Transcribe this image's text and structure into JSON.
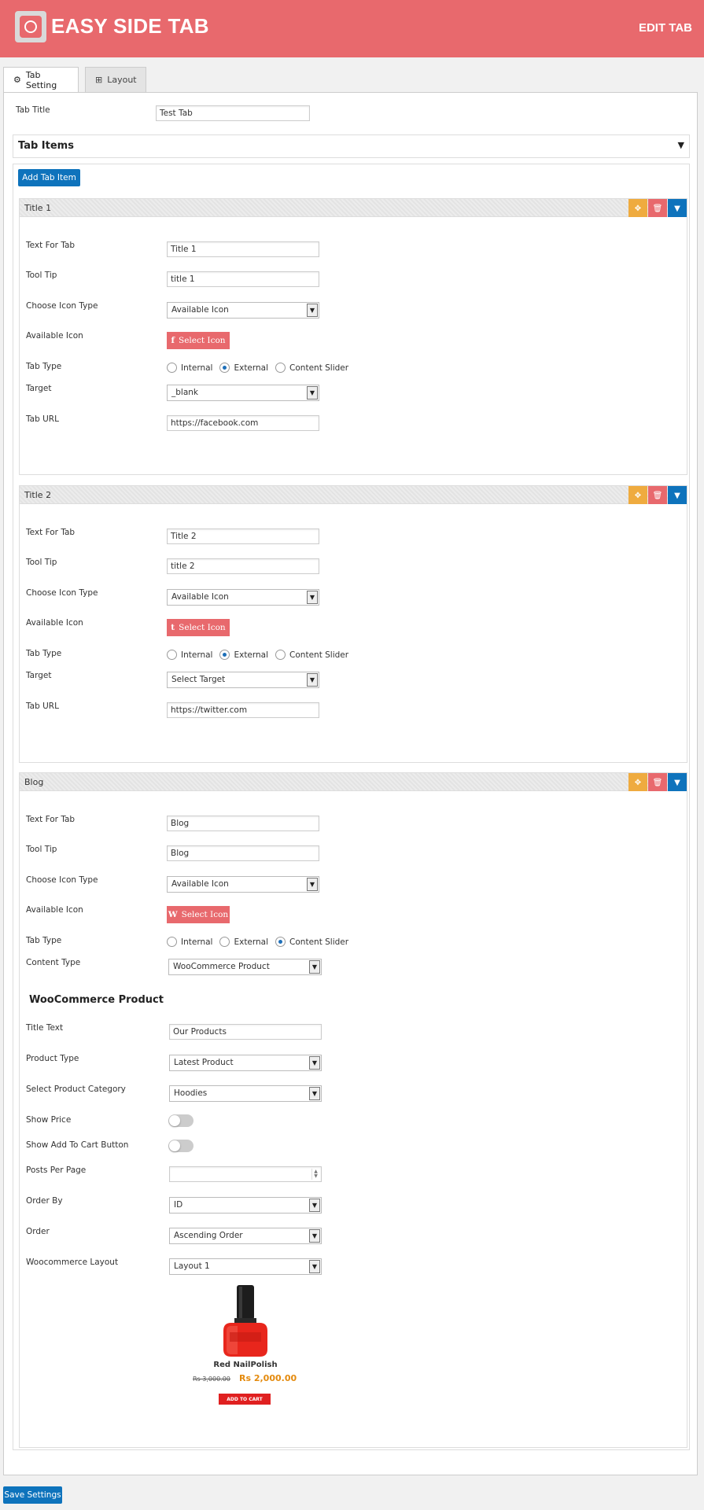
{
  "header": {
    "title": "EASY SIDE TAB",
    "action": "EDIT TAB",
    "logo_icon": "plugin-logo-icon"
  },
  "tabs": [
    {
      "label": "Tab Setting",
      "icon": "gear-icon"
    },
    {
      "label": "Layout",
      "icon": "grid-icon"
    }
  ],
  "tab_title": {
    "label": "Tab Title",
    "value": "Test Tab"
  },
  "tab_items": {
    "title": "Tab Items",
    "add_label": "Add Tab Item"
  },
  "items": [
    {
      "title": "Title 1",
      "text_label": "Text For Tab",
      "text_value": "Title 1",
      "tooltip_label": "Tool Tip",
      "tooltip_value": "title 1",
      "icon_type_label": "Choose Icon Type",
      "icon_type_value": "Available Icon",
      "icon_label": "Available Icon",
      "icon_btn": "Select Icon",
      "icon_glyph": "f",
      "tab_type_label": "Tab Type",
      "opt_internal": "Internal",
      "opt_external": "External",
      "opt_slider": "Content Slider",
      "target_label": "Target",
      "target_value": "_blank",
      "url_label": "Tab URL",
      "url_value": "https://facebook.com"
    },
    {
      "title": "Title 2",
      "text_label": "Text For Tab",
      "text_value": "Title 2",
      "tooltip_label": "Tool Tip",
      "tooltip_value": "title 2",
      "icon_type_label": "Choose Icon Type",
      "icon_type_value": "Available Icon",
      "icon_label": "Available Icon",
      "icon_btn": "Select Icon",
      "icon_glyph": "t",
      "tab_type_label": "Tab Type",
      "opt_internal": "Internal",
      "opt_external": "External",
      "opt_slider": "Content Slider",
      "target_label": "Target",
      "target_value": "Select Target",
      "url_label": "Tab URL",
      "url_value": "https://twitter.com"
    },
    {
      "title": "Blog",
      "text_label": "Text For Tab",
      "text_value": "Blog",
      "tooltip_label": "Tool Tip",
      "tooltip_value": "Blog",
      "icon_type_label": "Choose Icon Type",
      "icon_type_value": "Available Icon",
      "icon_label": "Available Icon",
      "icon_btn": "Select Icon",
      "icon_glyph": "W",
      "tab_type_label": "Tab Type",
      "opt_internal": "Internal",
      "opt_external": "External",
      "opt_slider": "Content Slider",
      "content_type_label": "Content Type",
      "content_type_value": "WooCommerce Product"
    }
  ],
  "woo": {
    "heading": "WooCommerce Product",
    "title_text_label": "Title Text",
    "title_text_value": "Our Products",
    "product_type_label": "Product Type",
    "product_type_value": "Latest Product",
    "category_label": "Select Product Category",
    "category_value": "Hoodies",
    "show_price_label": "Show Price",
    "show_cart_label": "Show Add To Cart Button",
    "posts_label": "Posts Per Page",
    "posts_value": "",
    "order_by_label": "Order By",
    "order_by_value": "ID",
    "order_label": "Order",
    "order_value": "Ascending Order",
    "layout_label": "Woocommerce Layout",
    "layout_value": "Layout 1",
    "product": {
      "name": "Red NailPolish",
      "old_price": "Rs 3,000.00",
      "new_price": "Rs 2,000.00",
      "cart_label": "ADD TO CART"
    }
  },
  "save_label": "Save Settings",
  "colors": {
    "brand": "#e8696d",
    "blue": "#0e73bc",
    "orange": "#efab3f"
  }
}
